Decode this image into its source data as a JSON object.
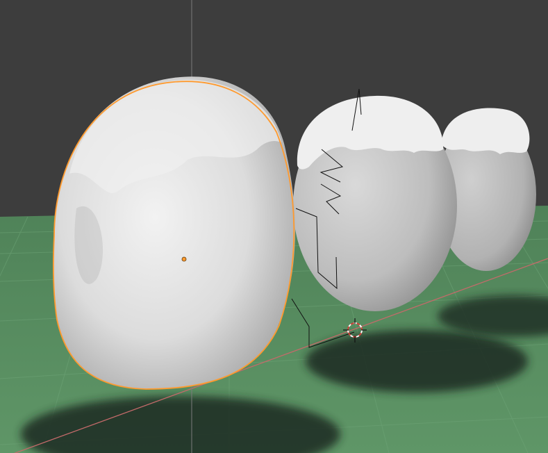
{
  "app": {
    "view": "3D viewport",
    "shading": "rendered"
  },
  "colors": {
    "background": "#3d3d3d",
    "ground": "#5a8f62",
    "ground_far": "#4c7d56",
    "grid": "#6ea477",
    "x_axis": "#c46a6a",
    "z_axis": "#a9a9a9",
    "selection_outline": "#ff9a2e",
    "origin_dot": "#ff9a2e",
    "snow": "#e9e9e9",
    "egg": "#c6c6c6",
    "shadow": "#1f2b22",
    "cursor_red": "#d0423a"
  },
  "objects": [
    {
      "name": "snow-egg-selected",
      "selected": true
    },
    {
      "name": "snow-capped-egg-middle",
      "selected": false
    },
    {
      "name": "snow-capped-egg-back",
      "selected": false
    }
  ],
  "icons": {
    "cursor": "3d-cursor-icon",
    "light": "light-object-icon"
  }
}
